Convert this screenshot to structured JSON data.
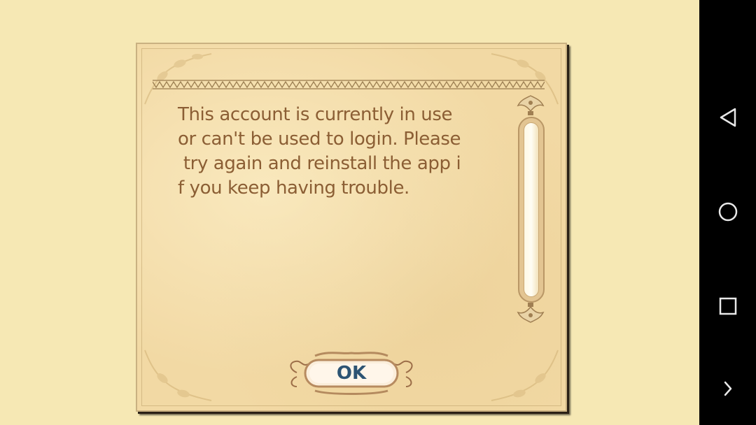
{
  "dialog": {
    "message_lines": [
      "This account is currently in use",
      "or can't be used to login. Please",
      " try again and reinstall the app i",
      "f you keep having trouble."
    ],
    "ok_label": "OK"
  },
  "scrollbar": {
    "position": 0
  },
  "navigation_bar": {
    "back": "back-icon",
    "home": "home-icon",
    "recents": "recents-icon",
    "more": "chevron-right-icon"
  },
  "colors": {
    "background": "#f6e8b4",
    "parchment": "#f2d9a4",
    "message_text": "#8b5e34",
    "ok_text": "#2d5473",
    "navbar": "#000000"
  }
}
